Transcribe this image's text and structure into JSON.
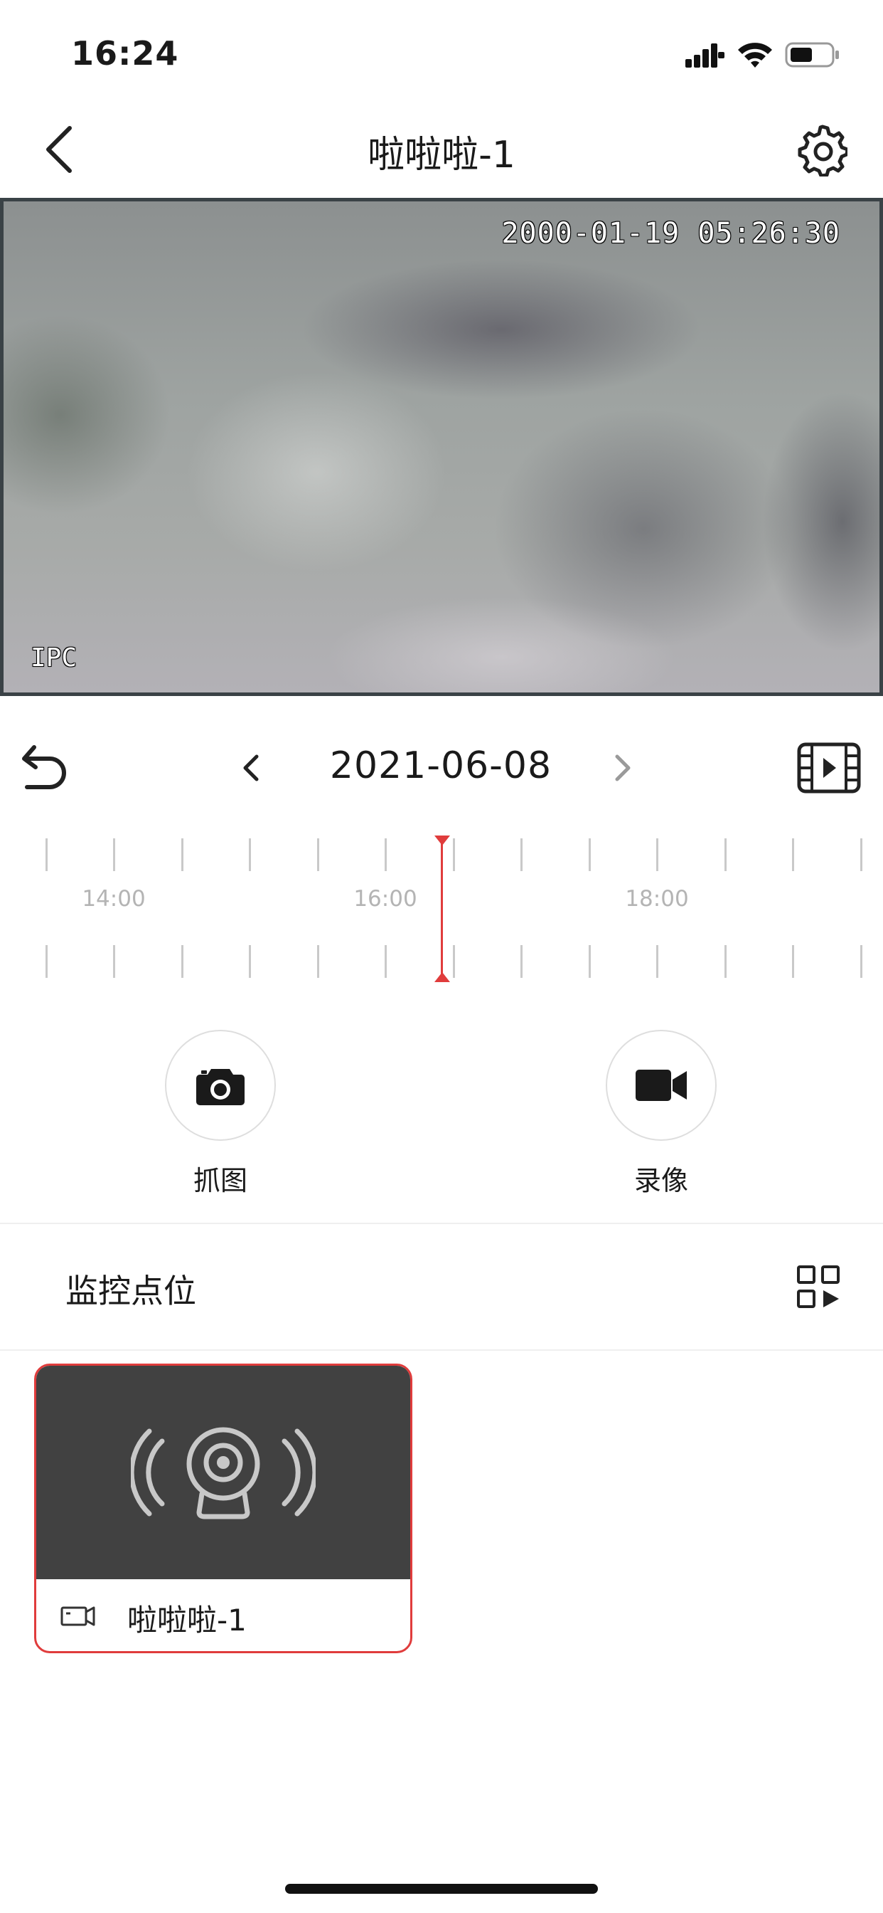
{
  "status_bar": {
    "time": "16:24"
  },
  "nav": {
    "title": "啦啦啦-1"
  },
  "video": {
    "osd_timestamp": "2000-01-19 05:26:30",
    "osd_label": "IPC"
  },
  "date_nav": {
    "date": "2021-06-08"
  },
  "timeline": {
    "labels": [
      "14:00",
      "16:00",
      "18:00"
    ],
    "accent": "#e03c3c"
  },
  "actions": {
    "snapshot_label": "抓图",
    "record_label": "录像"
  },
  "section": {
    "title": "监控点位"
  },
  "device_card": {
    "name": "啦啦啦-1",
    "selected": true
  }
}
